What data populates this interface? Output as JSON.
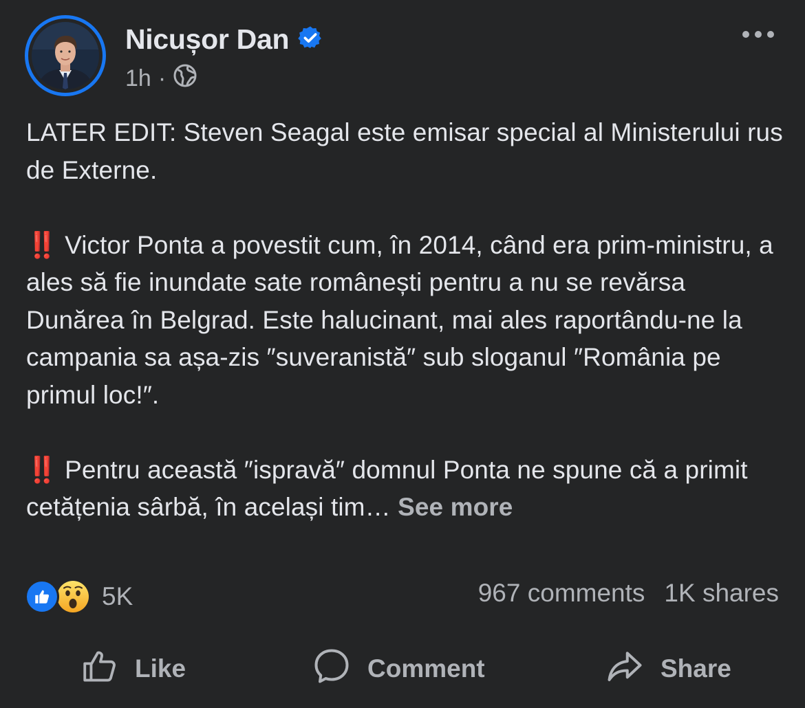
{
  "header": {
    "author_name": "Nicușor Dan",
    "time": "1h",
    "separator": "·",
    "verified_icon": "verified-badge-icon",
    "privacy_icon": "globe-icon",
    "menu_icon": "more-horizontal-icon"
  },
  "post": {
    "paragraph1": "LATER EDIT:  Steven Seagal este emisar special al Ministerului rus de Externe.",
    "paragraph2_marker": "‼️",
    "paragraph2": "Victor Ponta a povestit cum, în 2014, când era prim-ministru, a ales să fie inundate sate românești pentru a nu se revărsa Dunărea în Belgrad. Este halucinant, mai ales raportându-ne la campania sa așa-zis ″suveranistă″ sub sloganul ″România pe primul loc!″.",
    "paragraph3_marker": "‼️",
    "paragraph3": "Pentru această ″ispravă″ domnul Ponta ne spune că a primit cetățenia sârbă, în același tim…",
    "see_more": "See more"
  },
  "stats": {
    "reactions_count": "5K",
    "comments": "967 comments",
    "shares": "1K shares",
    "reaction_icons": [
      "like-reaction-icon",
      "wow-reaction-icon"
    ]
  },
  "actions": {
    "like": "Like",
    "comment": "Comment",
    "share": "Share"
  },
  "colors": {
    "background": "#242526",
    "primary_text": "#e4e6eb",
    "secondary_text": "#b0b3b8",
    "accent_blue": "#1877f2",
    "marker_red": "#e41e3f"
  }
}
